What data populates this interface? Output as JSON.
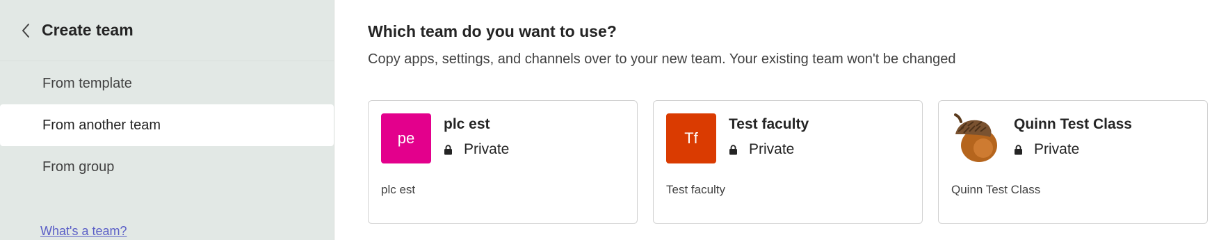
{
  "sidebar": {
    "title": "Create team",
    "items": [
      {
        "label": "From template",
        "active": false
      },
      {
        "label": "From another team",
        "active": true
      },
      {
        "label": "From group",
        "active": false
      }
    ],
    "help_link": "What's a team?"
  },
  "main": {
    "heading": "Which team do you want to use?",
    "subtitle": "Copy apps, settings, and channels over to your new team. Your existing team won't be changed",
    "teams": [
      {
        "initials": "pe",
        "name": "plc est",
        "privacy": "Private",
        "description": "plc est",
        "avatar_color": "#e3008c",
        "icon": ""
      },
      {
        "initials": "Tf",
        "name": "Test faculty",
        "privacy": "Private",
        "description": "Test faculty",
        "avatar_color": "#da3b01",
        "icon": ""
      },
      {
        "initials": "",
        "name": "Quinn Test Class",
        "privacy": "Private",
        "description": "Quinn Test Class",
        "avatar_color": "",
        "icon": "acorn-icon"
      }
    ]
  },
  "colors": {
    "sidebar_bg": "#e2e8e5",
    "link": "#5b5fc7",
    "text": "#242424"
  }
}
